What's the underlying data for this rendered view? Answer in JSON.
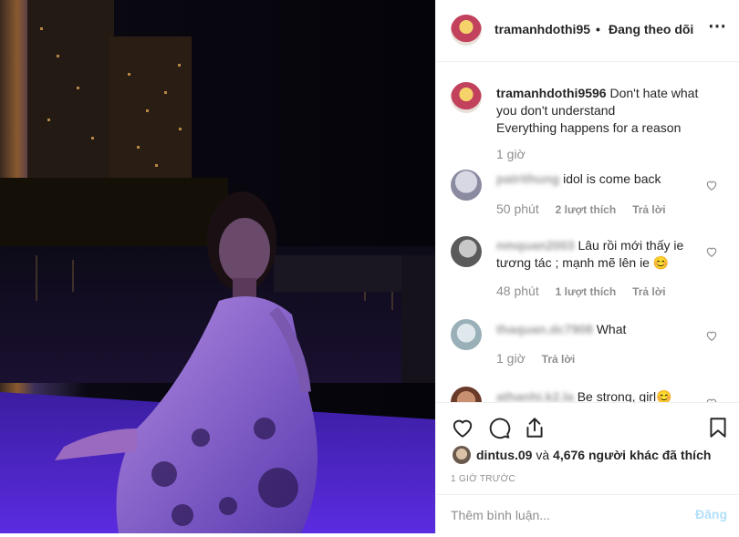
{
  "header": {
    "username": "tramanhdothi95",
    "separator": "•",
    "follow_status": "Đang theo dõi",
    "more_icon": "⋯"
  },
  "caption": {
    "username": "tramanhdothi9596",
    "text_line1": "Don't hate what",
    "text_line2": "you don't understand",
    "text_line3": "Everything happens for a reason",
    "time": "1 giờ"
  },
  "comments": [
    {
      "username": "patrithung",
      "text": "idol is come back",
      "time": "50 phút",
      "likes": "2 lượt thích",
      "reply": "Trả lời"
    },
    {
      "username": "nmquan2003",
      "text": "Lâu rồi mới thấy ie tương tác ; mạnh mẽ lên ie 😊",
      "time": "48 phút",
      "likes": "1 lượt thích",
      "reply": "Trả lời"
    },
    {
      "username": "thaquan.dc7908",
      "text": "What",
      "time": "1 giờ",
      "reply": "Trả lời"
    },
    {
      "username": "athanhi.k2.la",
      "text": "Be strong, girl😊"
    }
  ],
  "likes": {
    "first_user": "dintus.09",
    "connector": "và",
    "others": "4,676 người khác đã thích"
  },
  "post_time": "1 GIỜ TRƯỚC",
  "comment_box": {
    "placeholder": "Thêm bình luận...",
    "post_label": "Đăng"
  },
  "icons": {
    "like": "heart-icon",
    "comment": "comment-icon",
    "share": "share-icon",
    "save": "bookmark-icon"
  },
  "colors": {
    "link_disabled": "#b2dffc",
    "muted_text": "#8e8e8e",
    "primary_text": "#262626"
  }
}
